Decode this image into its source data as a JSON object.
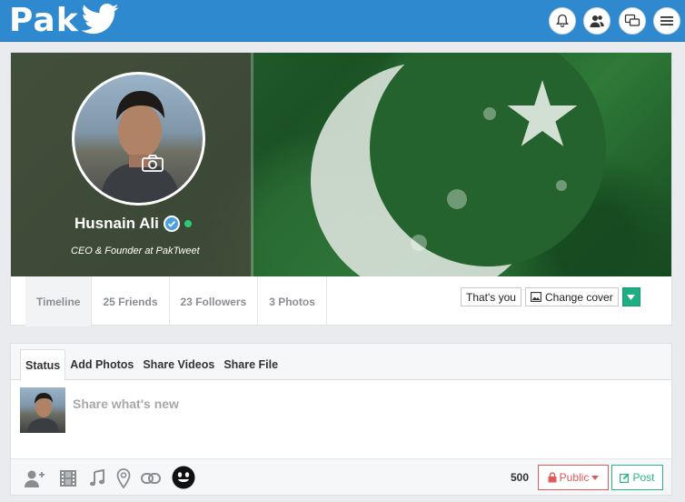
{
  "brand": {
    "name": "Pak"
  },
  "topbar": {
    "icons": [
      "bell-icon",
      "friends-icon",
      "messages-icon",
      "menu-icon"
    ]
  },
  "profile": {
    "name": "Husnain Ali",
    "title": "CEO & Founder at PakTweet",
    "verified": true,
    "online": true
  },
  "profile_tabs": [
    {
      "label": "Timeline",
      "active": true
    },
    {
      "label": "25 Friends"
    },
    {
      "label": "23 Followers"
    },
    {
      "label": "3 Photos"
    }
  ],
  "cover_actions": {
    "thats_you": "That's you",
    "change_cover": "Change cover"
  },
  "composer": {
    "tabs": [
      "Status",
      "Add Photos",
      "Share Videos",
      "Share File"
    ],
    "active_tab": "Status",
    "placeholder": "Share what's new",
    "char_count": "500",
    "privacy_label": "Public",
    "post_label": "Post"
  },
  "colors": {
    "topbar": "#2f89cf",
    "accent_green": "#1fae84",
    "danger": "#e05a5a"
  }
}
